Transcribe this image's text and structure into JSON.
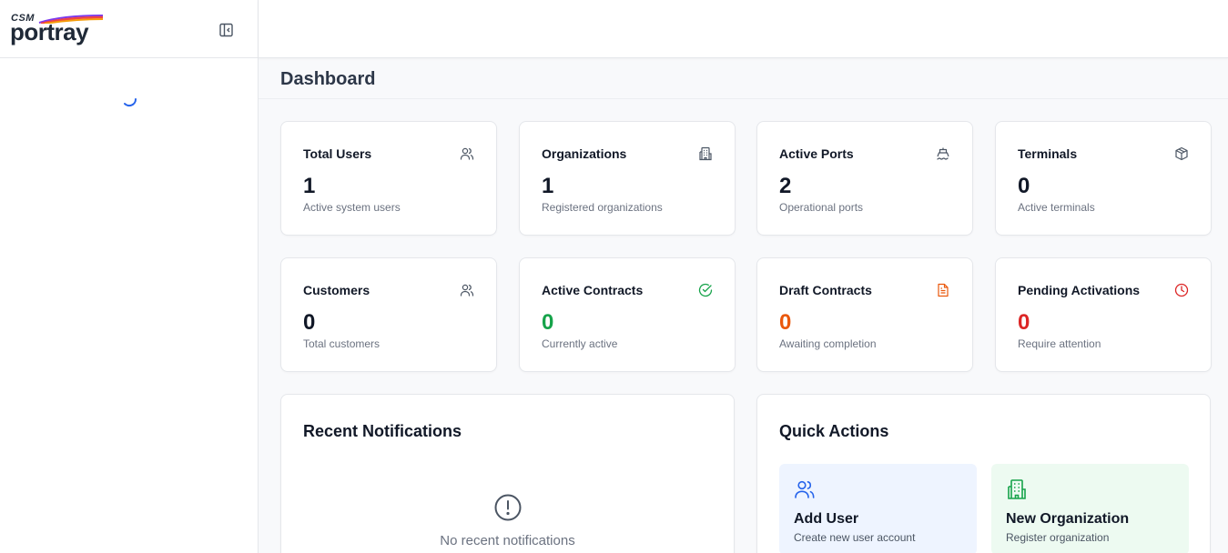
{
  "brand": {
    "csm": "CSM",
    "name": "portray"
  },
  "page": {
    "title": "Dashboard"
  },
  "stats": [
    {
      "title": "Total Users",
      "value": "1",
      "desc": "Active system users",
      "icon": "users-icon"
    },
    {
      "title": "Organizations",
      "value": "1",
      "desc": "Registered organizations",
      "icon": "building-icon"
    },
    {
      "title": "Active Ports",
      "value": "2",
      "desc": "Operational ports",
      "icon": "ship-icon"
    },
    {
      "title": "Terminals",
      "value": "0",
      "desc": "Active terminals",
      "icon": "box-icon"
    },
    {
      "title": "Customers",
      "value": "0",
      "desc": "Total customers",
      "icon": "users-icon"
    },
    {
      "title": "Active Contracts",
      "value": "0",
      "desc": "Currently active",
      "icon": "check-circle-icon",
      "color": "#16a34a"
    },
    {
      "title": "Draft Contracts",
      "value": "0",
      "desc": "Awaiting completion",
      "icon": "document-icon",
      "color": "#ea580c"
    },
    {
      "title": "Pending Activations",
      "value": "0",
      "desc": "Require attention",
      "icon": "clock-icon",
      "color": "#dc2626"
    }
  ],
  "notifications": {
    "title": "Recent Notifications",
    "empty": "No recent notifications"
  },
  "quick_actions": {
    "title": "Quick Actions",
    "items": [
      {
        "title": "Add User",
        "desc": "Create new user account",
        "icon": "users-icon",
        "color": "#2563eb"
      },
      {
        "title": "New Organization",
        "desc": "Register organization",
        "icon": "building-icon",
        "color": "#16a34a"
      }
    ]
  }
}
